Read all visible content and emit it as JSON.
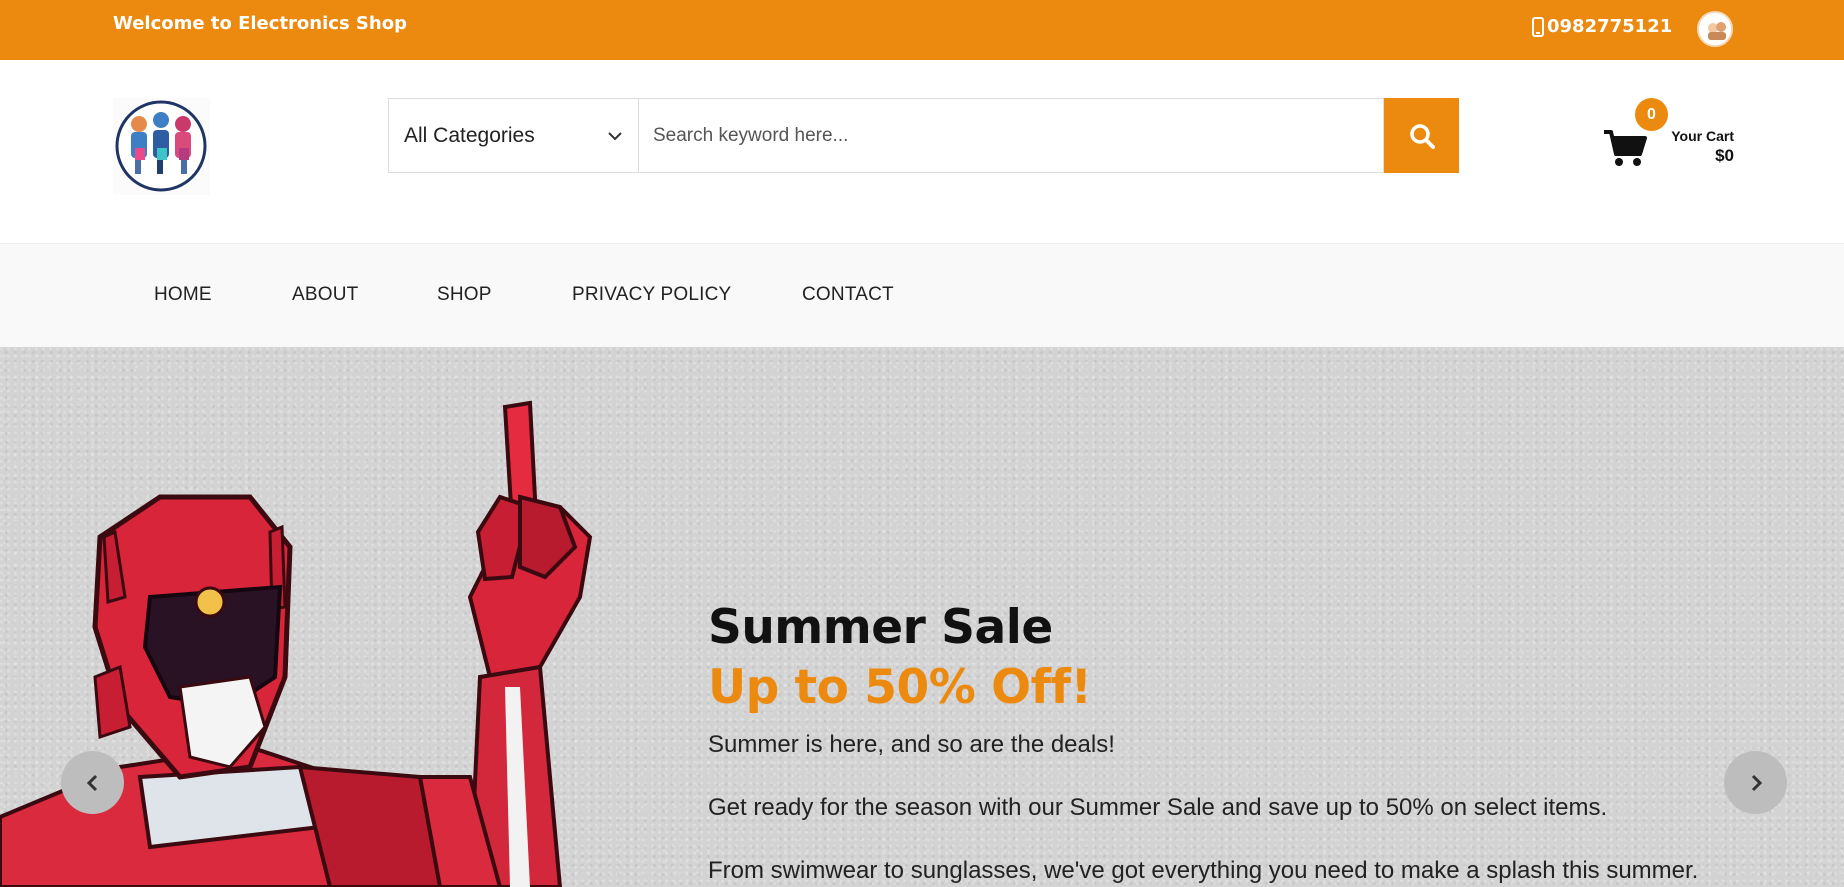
{
  "topbar": {
    "welcome": "Welcome to Electronics Shop",
    "phone": "0982775121",
    "bg_color": "#eb8a0f"
  },
  "header": {
    "category_selected": "All Categories",
    "search_placeholder": "Search keyword here...",
    "cart": {
      "count": "0",
      "label": "Your Cart",
      "total": "$0"
    }
  },
  "nav": {
    "items": [
      "HOME",
      "ABOUT",
      "SHOP",
      "PRIVACY POLICY",
      "CONTACT"
    ]
  },
  "hero": {
    "title": "Summer Sale",
    "subtitle": "Up to 50% Off!",
    "p1": "Summer is here, and so are the deals!",
    "p2": "Get ready for the season with our Summer Sale and save up to 50% on select items.",
    "p3": "From swimwear to sunglasses, we've got everything you need to make a splash this summer."
  },
  "icons": {
    "phone": "mobile-phone-icon",
    "search": "search-icon",
    "cart": "shopping-cart-icon",
    "dropdown": "chevron-down-icon",
    "prev": "chevron-left-icon",
    "next": "chevron-right-icon"
  }
}
